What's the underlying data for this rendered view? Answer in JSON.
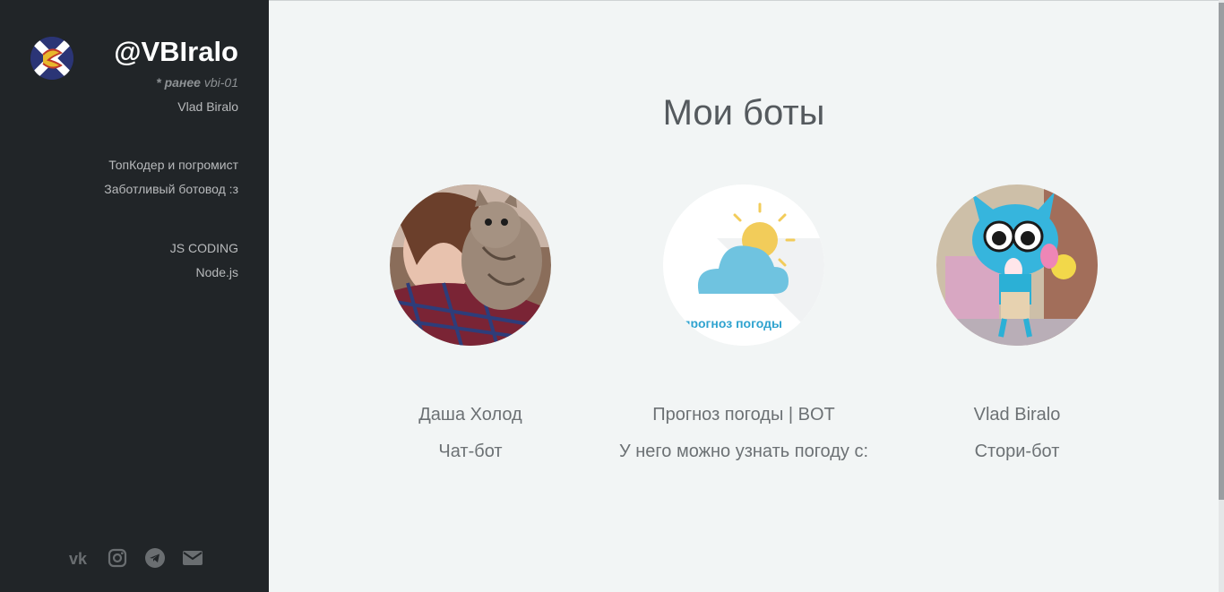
{
  "sidebar": {
    "handle": "@VBIralo",
    "former_prefix": "* ранее",
    "former_name": "vbi-01",
    "real_name": "Vlad Biralo",
    "taglines": [
      "ТопКодер и погромист",
      "Заботливый ботовод :з",
      "JS CODING",
      "Node.js"
    ],
    "social": [
      {
        "name": "vk-icon"
      },
      {
        "name": "instagram-icon"
      },
      {
        "name": "telegram-icon"
      },
      {
        "name": "email-icon"
      }
    ]
  },
  "main": {
    "title": "Мои боты",
    "bots": [
      {
        "name": "Даша Холод",
        "description": "Чат-бот"
      },
      {
        "name": "Прогноз погоды | BOT",
        "description": "У него можно узнать погоду с:",
        "image_text": "прогноз погоды"
      },
      {
        "name": "Vlad Biralo",
        "description": "Стори-бот"
      }
    ]
  }
}
